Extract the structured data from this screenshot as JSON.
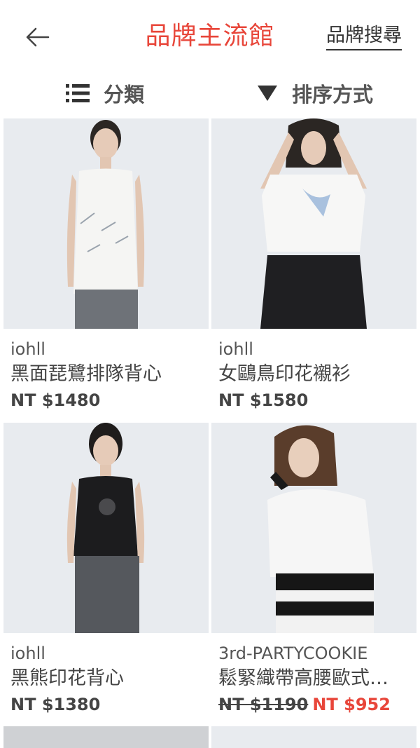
{
  "header": {
    "title": "品牌主流館",
    "search_label": "品牌搜尋"
  },
  "toolbar": {
    "category_label": "分類",
    "sort_label": "排序方式"
  },
  "products": [
    {
      "brand": "iohll",
      "name": "黑面琵鷺排隊背心",
      "price": "NT $1480"
    },
    {
      "brand": "iohll",
      "name": "女鷗鳥印花襯衫",
      "price": "NT $1580"
    },
    {
      "brand": "iohll",
      "name": "黑熊印花背心",
      "price": "NT $1380"
    },
    {
      "brand": "3rd-PARTYCOOKIE",
      "name": "鬆緊織帶高腰歐式…",
      "old_price": "NT $1190",
      "sale_price": "NT $952"
    }
  ],
  "colors": {
    "accent": "#e8463a",
    "text": "#444444",
    "photo_bg": "#e9ecf1"
  }
}
